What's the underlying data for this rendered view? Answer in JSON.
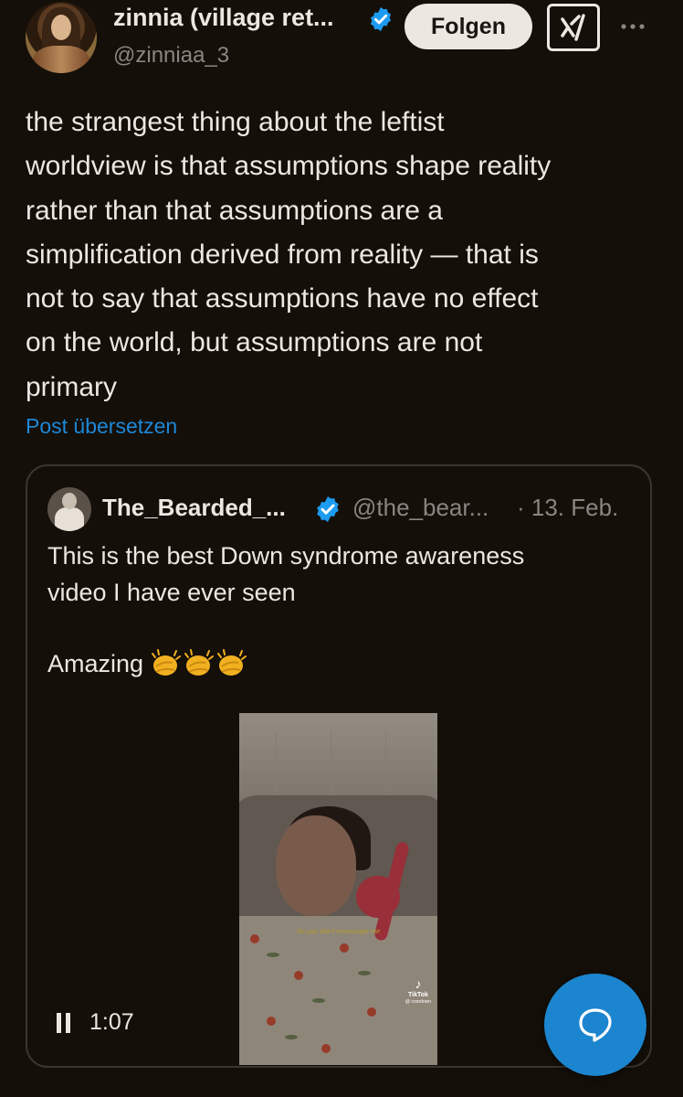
{
  "author": {
    "display_name": "zinnia (village ret...",
    "handle": "@zinniaa_3"
  },
  "actions": {
    "follow_label": "Folgen",
    "grok_icon": "grok-icon",
    "more_icon": "more-icon"
  },
  "post": {
    "text": "the strangest thing about the leftist\nworldview is that assumptions shape reality\nrather than that assumptions are a\nsimplification derived from reality — that is\nnot to say that assumptions have no effect\non the world, but assumptions are not\nprimary",
    "translate_label": "Post übersetzen"
  },
  "quote": {
    "display_name": "The_Bearded_...",
    "handle": "@the_bear...",
    "date": "· 13. Feb.",
    "text": "This is the best Down syndrome awareness\nvideo I have ever seen",
    "text2": "Amazing",
    "emoji_icon": "clapping-hands-icon",
    "video": {
      "caption": "So you don't encourage me",
      "watermark": "TikTok",
      "watermark_user": "@ coordown",
      "duration": "1:07"
    }
  },
  "fab": {
    "icon": "reply-bubble-icon"
  },
  "colors": {
    "background": "#140f08",
    "accent": "#1d88d8",
    "fab": "#1c85cf",
    "text": "#ece8e1",
    "muted": "#8a8580"
  }
}
